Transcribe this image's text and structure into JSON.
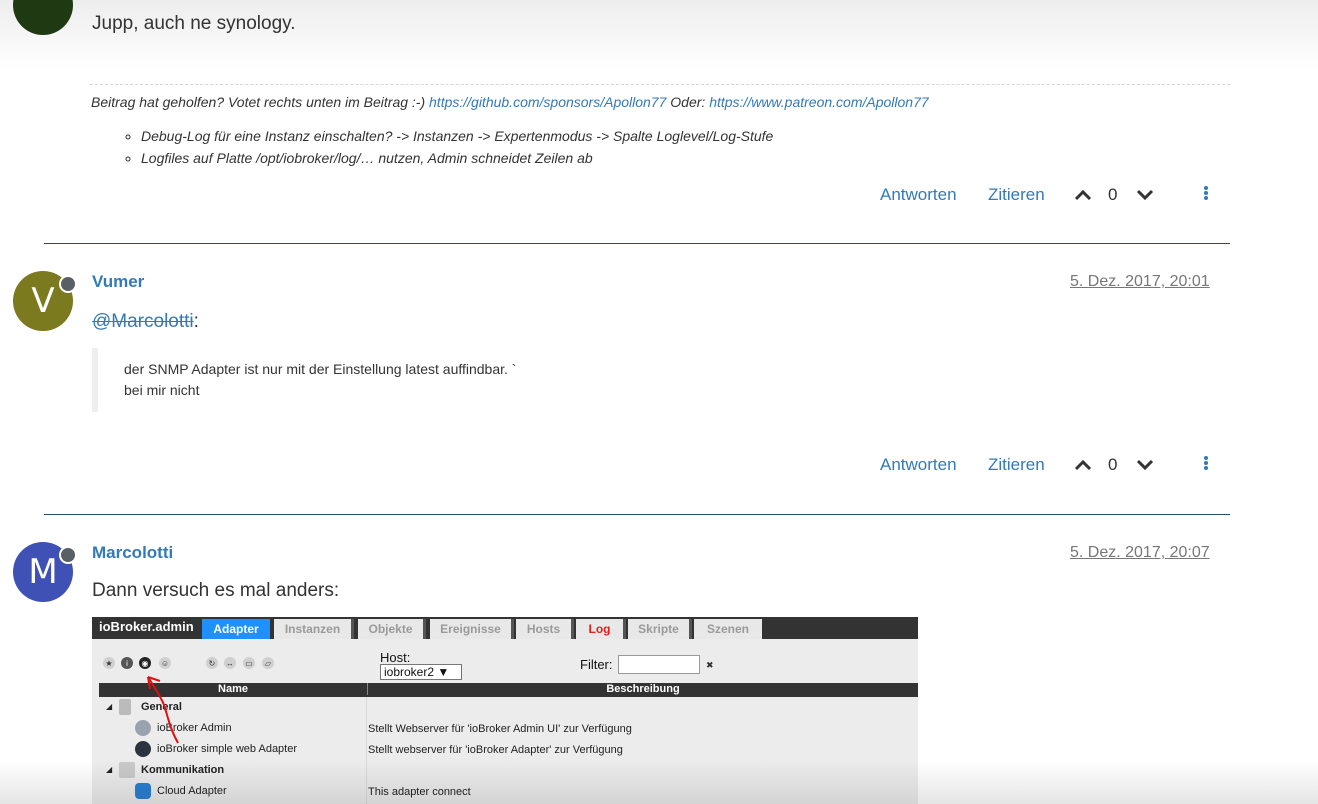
{
  "post1": {
    "text": "Jupp, auch ne synology.",
    "signature": {
      "prefix": "Beitrag hat geholfen? Votet rechts unten im Beitrag :-) ",
      "link1": "https://github.com/sponsors/Apollon77",
      "middle": " Oder: ",
      "link2": "https://www.patreon.com/Apollon77",
      "items": [
        "Debug-Log für eine Instanz einschalten? -> Instanzen -> Expertenmodus -> Spalte Loglevel/Log-Stufe",
        "Logfiles auf Platte /opt/iobroker/log/… nutzen, Admin schneidet Zeilen ab"
      ]
    },
    "actions": {
      "reply": "Antworten",
      "quote": "Zitieren",
      "votes": "0"
    }
  },
  "post2": {
    "avatar_letter": "V",
    "avatar_color": "#7b7a1e",
    "username": "Vumer",
    "timestamp": "5. Dez. 2017, 20:01",
    "mention": "@Marcolotti",
    "mention_suffix": ":",
    "quote_line1": "der SNMP Adapter ist nur mit der Einstellung latest auffindbar. `",
    "quote_line2": "bei mir nicht",
    "actions": {
      "reply": "Antworten",
      "quote": "Zitieren",
      "votes": "0"
    }
  },
  "post3": {
    "avatar_letter": "M",
    "avatar_color": "#3f51b5",
    "username": "Marcolotti",
    "timestamp": "5. Dez. 2017, 20:07",
    "text": "Dann versuch es mal anders:"
  },
  "screenshot": {
    "brand": "ioBroker.admin",
    "tabs": [
      "Adapter",
      "Instanzen",
      "Objekte",
      "Ereignisse",
      "Hosts",
      "Log",
      "Skripte",
      "Szenen"
    ],
    "host_label": "Host:",
    "host_value": "iobroker2 ▼",
    "filter_label": "Filter:",
    "filter_clear": "✖",
    "col_name": "Name",
    "col_desc": "Beschreibung",
    "rows": [
      {
        "name": "General",
        "desc": ""
      },
      {
        "name": "ioBroker Admin",
        "desc": "Stellt Webserver für 'ioBroker Admin UI' zur Verfügung"
      },
      {
        "name": "ioBroker simple web Adapter",
        "desc": "Stellt webserver für 'ioBroker Adapter' zur Verfügung"
      },
      {
        "name": "Kommunikation",
        "desc": ""
      },
      {
        "name": "Cloud Adapter",
        "desc": "This adapter connect"
      }
    ]
  }
}
